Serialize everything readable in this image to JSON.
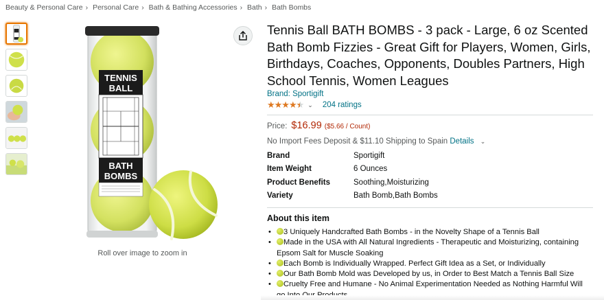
{
  "breadcrumb": [
    "Beauty & Personal Care",
    "Personal Care",
    "Bath & Bathing Accessories",
    "Bath",
    "Bath Bombs"
  ],
  "gallery": {
    "thumbnails": [
      "product-tube",
      "bath-bomb-front",
      "bath-bomb-top",
      "hand-holding-bomb",
      "bombs-row",
      "bombs-in-water"
    ],
    "main_label_top": "TENNIS BALL",
    "main_label_bottom": "BATH BOMBS",
    "zoom_hint": "Roll over image to zoom in"
  },
  "product": {
    "title": "Tennis Ball BATH BOMBS - 3 pack - Large, 6 oz Scented Bath Bomb Fizzies - Great Gift for Players, Women, Girls, Birthdays, Coaches, Opponents, Doubles Partners, High School Tennis, Women Leagues",
    "brand": "Brand: Sportigift",
    "rating_value": 4.5,
    "ratings_count": "204 ratings",
    "price_label": "Price:",
    "price": "$16.99",
    "unit_price": "($5.66 / Count)",
    "shipping": "No Import Fees Deposit & $11.10 Shipping to Spain",
    "shipping_link": "Details"
  },
  "specs": [
    {
      "key": "Brand",
      "value": "Sportigift"
    },
    {
      "key": "Item Weight",
      "value": "6 Ounces"
    },
    {
      "key": "Product Benefits",
      "value": "Soothing,Moisturizing"
    },
    {
      "key": "Variety",
      "value": "Bath Bomb,Bath Bombs"
    }
  ],
  "about": {
    "heading": "About this item",
    "bullets": [
      "3 Uniquely Handcrafted Bath Bombs - in the Novelty Shape of a Tennis Ball",
      "Made in the USA with All Natural Ingredients - Therapeutic and Moisturizing, containing Epsom Salt for Muscle Soaking",
      "Each Bomb is Individually Wrapped. Perfect Gift Idea as a Set, or Individually",
      "Our Bath Bomb Mold was Developed by us, in Order to Best Match a Tennis Ball Size",
      "Cruelty Free and Humane - No Animal Experimentation Needed as Nothing Harmful Will go Into Our Products"
    ]
  },
  "colors": {
    "link": "#007185",
    "price": "#b12704",
    "star": "#de7921",
    "active_thumb": "#e77600"
  }
}
